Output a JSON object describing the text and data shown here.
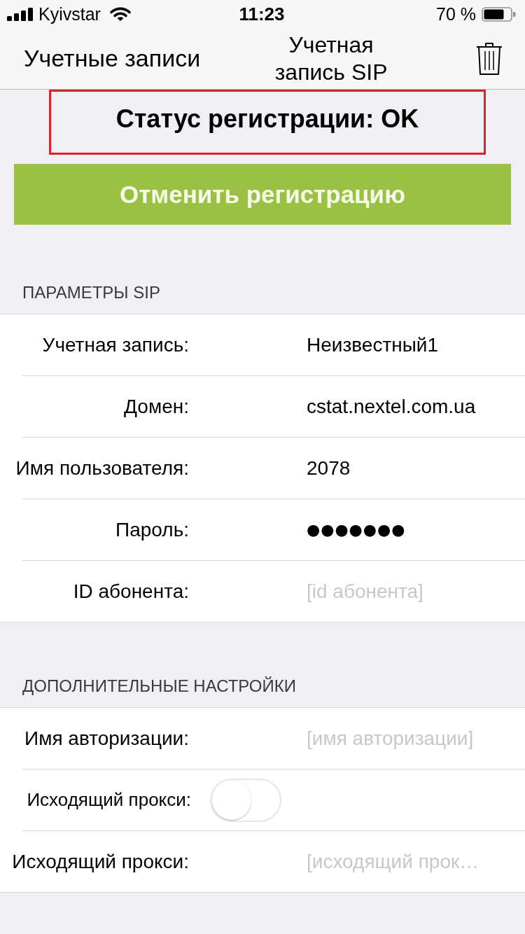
{
  "status_bar": {
    "carrier": "Kyivstar",
    "time": "11:23",
    "battery": "70 %"
  },
  "nav_bar": {
    "back": "Учетные записи",
    "title": "Учетная запись SIP"
  },
  "registration_status": "Статус регистрации: OK",
  "unregister_button": "Отменить регистрацию",
  "sections": [
    {
      "title": "ПАРАМЕТРЫ SIP",
      "rows": [
        {
          "kind": "text",
          "label": "Учетная запись:",
          "value": "Неизвестный1"
        },
        {
          "kind": "text",
          "label": "Домен:",
          "value": "cstat.nextel.com.ua"
        },
        {
          "kind": "text",
          "label": "Имя пользователя:",
          "value": "2078"
        },
        {
          "kind": "password",
          "label": "Пароль:",
          "value": "●●●●●●●"
        },
        {
          "kind": "text",
          "label": "ID абонента:",
          "placeholder": "[id абонента]"
        }
      ]
    },
    {
      "title": "ДОПОЛНИТЕЛЬНЫЕ НАСТРОЙКИ",
      "rows": [
        {
          "kind": "text",
          "label": "Имя авторизации:",
          "placeholder": "[имя авторизации]"
        },
        {
          "kind": "switch",
          "label": "Исходящий прокси:",
          "on": false
        },
        {
          "kind": "text",
          "label": "Исходящий прокси:",
          "placeholder": "[исходящий прок…"
        }
      ]
    }
  ]
}
